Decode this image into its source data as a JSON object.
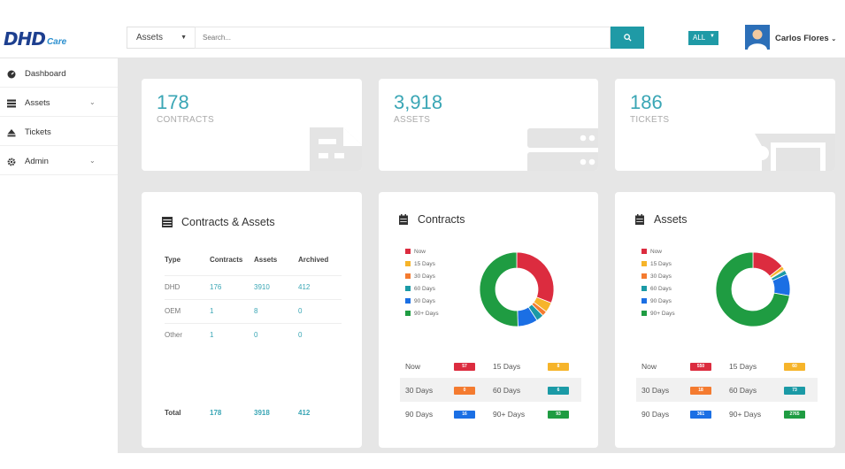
{
  "header": {
    "logo_main": "DHD",
    "logo_sub": "Care",
    "search_category": "Assets",
    "search_placeholder": "Search...",
    "filter_label": "ALL",
    "user_name": "Carlos Flores"
  },
  "sidebar": {
    "items": [
      {
        "label": "Dashboard",
        "icon": "dashboard-icon",
        "expandable": false
      },
      {
        "label": "Assets",
        "icon": "list-icon",
        "expandable": true
      },
      {
        "label": "Tickets",
        "icon": "eject-icon",
        "expandable": false
      },
      {
        "label": "Admin",
        "icon": "gear-icon",
        "expandable": true
      }
    ]
  },
  "kpis": [
    {
      "value": "178",
      "label": "CONTRACTS",
      "icon": "contract-icon"
    },
    {
      "value": "3,918",
      "label": "ASSETS",
      "icon": "server-icon"
    },
    {
      "value": "186",
      "label": "TICKETS",
      "icon": "ticket-icon"
    }
  ],
  "contracts_assets": {
    "title": "Contracts & Assets",
    "columns": [
      "Type",
      "Contracts",
      "Assets",
      "Archived"
    ],
    "rows": [
      [
        "DHD",
        "176",
        "3910",
        "412"
      ],
      [
        "OEM",
        "1",
        "8",
        "0"
      ],
      [
        "Other",
        "1",
        "0",
        "0"
      ]
    ],
    "total": [
      "Total",
      "178",
      "3918",
      "412"
    ]
  },
  "legend_labels": [
    "Now",
    "15 Days",
    "30 Days",
    "60 Days",
    "90 Days",
    "90+ Days"
  ],
  "colors": {
    "accent": "#1f9aa6",
    "now": "#dc2c3f",
    "d15": "#f6b42a",
    "d30": "#f47b30",
    "d60": "#1b9aa6",
    "d90": "#1b6fe4",
    "d90plus": "#1f9c42"
  },
  "contracts_chart": {
    "title": "Contracts",
    "stats": [
      {
        "label": "Now",
        "value": "57"
      },
      {
        "label": "15 Days",
        "value": "8"
      },
      {
        "label": "30 Days",
        "value": "0"
      },
      {
        "label": "60 Days",
        "value": "6"
      },
      {
        "label": "90 Days",
        "value": "16"
      },
      {
        "label": "90+ Days",
        "value": "93"
      }
    ]
  },
  "assets_chart": {
    "title": "Assets",
    "stats": [
      {
        "label": "Now",
        "value": "550"
      },
      {
        "label": "15 Days",
        "value": "60"
      },
      {
        "label": "30 Days",
        "value": "18"
      },
      {
        "label": "60 Days",
        "value": "73"
      },
      {
        "label": "90 Days",
        "value": "361"
      },
      {
        "label": "90+ Days",
        "value": "2765"
      }
    ]
  },
  "chart_data": [
    {
      "type": "pie",
      "title": "Contracts",
      "categories": [
        "Now",
        "15 Days",
        "30 Days",
        "60 Days",
        "90 Days",
        "90+ Days"
      ],
      "values": [
        57,
        8,
        4,
        6,
        16,
        93
      ]
    },
    {
      "type": "pie",
      "title": "Assets",
      "categories": [
        "Now",
        "15 Days",
        "30 Days",
        "60 Days",
        "90 Days",
        "90+ Days"
      ],
      "values": [
        550,
        60,
        18,
        73,
        361,
        2765
      ]
    }
  ]
}
